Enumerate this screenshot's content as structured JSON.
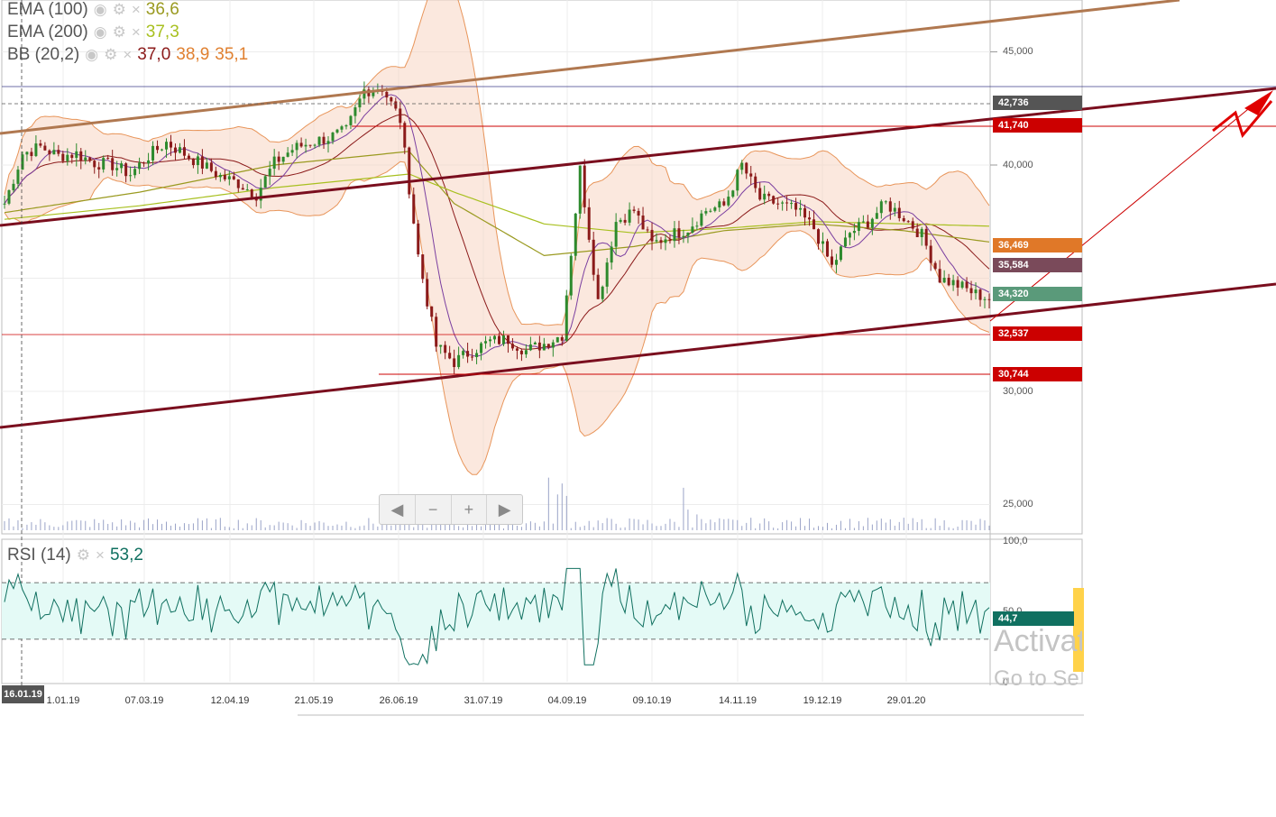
{
  "indicators": [
    {
      "name": "EMA (100)",
      "values": [
        {
          "text": "36,6",
          "color": "#9a9a20"
        }
      ]
    },
    {
      "name": "EMA (200)",
      "values": [
        {
          "text": "37,3",
          "color": "#a8c020"
        }
      ]
    },
    {
      "name": "BB (20,2)",
      "values": [
        {
          "text": "37,0",
          "color": "#8b1a1a"
        },
        {
          "text": "38,9",
          "color": "#e08030"
        },
        {
          "text": "35,1",
          "color": "#e08030"
        }
      ]
    }
  ],
  "rsi": {
    "name": "RSI (14)",
    "value": "53,2",
    "value_color": "#107060",
    "badge": "44,7",
    "axis_top": "100,0",
    "axis_mid": "50,0",
    "axis_bottom": "0"
  },
  "price_axis": [
    "45,000",
    "40,000",
    "30,000",
    "25,000"
  ],
  "price_tags": [
    {
      "text": "42,736",
      "color": "#555555",
      "price": 42.736
    },
    {
      "text": "41,740",
      "color": "#cc0000",
      "price": 41.74
    },
    {
      "text": "36,469",
      "color": "#e07828",
      "price": 36.469
    },
    {
      "text": "35,584",
      "color": "#7a4a5a",
      "price": 35.584
    },
    {
      "text": "34,320",
      "color": "#5a9a7a",
      "price": 34.32
    },
    {
      "text": "32,537",
      "color": "#cc0000",
      "price": 32.537
    },
    {
      "text": "30,744",
      "color": "#cc0000",
      "price": 30.744
    }
  ],
  "date_labels": [
    "1.01.19",
    "07.03.19",
    "12.04.19",
    "21.05.19",
    "26.06.19",
    "31.07.19",
    "04.09.19",
    "09.10.19",
    "14.11.19",
    "19.12.19",
    "29.01.20"
  ],
  "current_date": "16.01.19",
  "nav": {
    "prev": "◀",
    "zoom_out": "−",
    "zoom_in": "+",
    "next": "▶"
  },
  "watermark": {
    "line1": "Activat",
    "line2": "Go to Se"
  },
  "icons": {
    "eye": "eye-icon",
    "gear": "gear-icon",
    "close": "close-icon"
  },
  "chart_data": {
    "type": "line",
    "subtype": "candlestick-with-indicators",
    "ylim": [
      22.5,
      47.5
    ],
    "grid": true,
    "dates": [
      "1.01.19",
      "07.03.19",
      "12.04.19",
      "21.05.19",
      "26.06.19",
      "31.07.19",
      "04.09.19",
      "09.10.19",
      "14.11.19",
      "19.12.19",
      "29.01.20"
    ],
    "series": [
      {
        "name": "price",
        "color": "#2d7a2d",
        "x": [
          0,
          4,
          8,
          12,
          16,
          20,
          24,
          28,
          32,
          36,
          40,
          44,
          48,
          52,
          56,
          60,
          64,
          68,
          72,
          76,
          80,
          84,
          88,
          92,
          96,
          100,
          104,
          108,
          112,
          116,
          120,
          124,
          128,
          132,
          136,
          140,
          144,
          148,
          152,
          156,
          160,
          164,
          168,
          172,
          176,
          180,
          184,
          188,
          192,
          196,
          200,
          204,
          208,
          212,
          216,
          219
        ],
        "y": [
          38.3,
          40.5,
          40.8,
          40.4,
          40.5,
          40.1,
          40.0,
          39.6,
          40.4,
          41.0,
          40.5,
          40.0,
          39.5,
          39.2,
          38.7,
          40.1,
          40.7,
          41.0,
          41.2,
          41.5,
          43.3,
          43.4,
          42.0,
          36.0,
          32.0,
          31.3,
          31.8,
          32.2,
          32.3,
          31.8,
          32.1,
          32.5,
          39.8,
          34.0,
          37.5,
          38.0,
          36.5,
          36.9,
          37.2,
          38.0,
          38.2,
          40.0,
          38.5,
          38.3,
          38.0,
          37.2,
          35.5,
          37.0,
          37.5,
          38.3,
          37.7,
          36.9,
          35.0,
          34.7,
          34.3,
          34.1
        ]
      },
      {
        "name": "EMA (100)",
        "color": "#9a9a20",
        "x": [
          0,
          30,
          60,
          90,
          100,
          120,
          140,
          160,
          180,
          200,
          219
        ],
        "y": [
          37.9,
          38.8,
          40.0,
          40.6,
          38.3,
          36.0,
          36.4,
          37.1,
          37.4,
          37.1,
          36.6
        ]
      },
      {
        "name": "EMA (200)",
        "color": "#a8c020",
        "x": [
          0,
          30,
          60,
          90,
          100,
          120,
          140,
          160,
          180,
          200,
          219
        ],
        "y": [
          37.6,
          38.2,
          39.0,
          39.6,
          38.8,
          37.4,
          37.0,
          37.2,
          37.5,
          37.4,
          37.3
        ]
      }
    ]
  }
}
